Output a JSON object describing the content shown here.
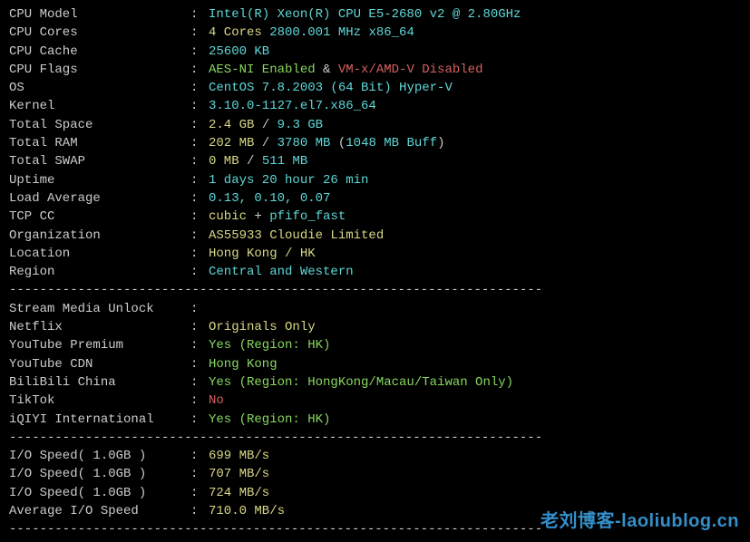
{
  "divider": "----------------------------------------------------------------------",
  "system": [
    {
      "label": "CPU Model",
      "segments": [
        {
          "t": "Intel(R) Xeon(R) CPU E5-2680 v2 @ 2.80GHz",
          "c": "cyan"
        }
      ]
    },
    {
      "label": "CPU Cores",
      "segments": [
        {
          "t": "4 Cores",
          "c": "yellow"
        },
        {
          "t": " ",
          "c": "white"
        },
        {
          "t": "2800.001 MHz",
          "c": "cyan"
        },
        {
          "t": " ",
          "c": "white"
        },
        {
          "t": "x86_64",
          "c": "cyan"
        }
      ]
    },
    {
      "label": "CPU Cache",
      "segments": [
        {
          "t": "25600 KB",
          "c": "cyan"
        }
      ]
    },
    {
      "label": "CPU Flags",
      "segments": [
        {
          "t": "AES-NI Enabled",
          "c": "green"
        },
        {
          "t": " & ",
          "c": "white"
        },
        {
          "t": "VM-x/AMD-V Disabled",
          "c": "red"
        }
      ]
    },
    {
      "label": "OS",
      "segments": [
        {
          "t": "CentOS 7.8.2003 (64 Bit)",
          "c": "cyan"
        },
        {
          "t": " ",
          "c": "white"
        },
        {
          "t": "Hyper-V",
          "c": "cyan"
        }
      ]
    },
    {
      "label": "Kernel",
      "segments": [
        {
          "t": "3.10.0-1127.el7.x86_64",
          "c": "cyan"
        }
      ]
    },
    {
      "label": "Total Space",
      "segments": [
        {
          "t": "2.4 GB",
          "c": "yellow"
        },
        {
          "t": " / ",
          "c": "white"
        },
        {
          "t": "9.3 GB",
          "c": "cyan"
        }
      ]
    },
    {
      "label": "Total RAM",
      "segments": [
        {
          "t": "202 MB",
          "c": "yellow"
        },
        {
          "t": " / ",
          "c": "white"
        },
        {
          "t": "3780 MB",
          "c": "cyan"
        },
        {
          "t": " (",
          "c": "white"
        },
        {
          "t": "1048 MB Buff",
          "c": "cyan"
        },
        {
          "t": ")",
          "c": "white"
        }
      ]
    },
    {
      "label": "Total SWAP",
      "segments": [
        {
          "t": "0 MB",
          "c": "yellow"
        },
        {
          "t": " / ",
          "c": "white"
        },
        {
          "t": "511 MB",
          "c": "cyan"
        }
      ]
    },
    {
      "label": "Uptime",
      "segments": [
        {
          "t": "1 days 20 hour 26 min",
          "c": "cyan"
        }
      ]
    },
    {
      "label": "Load Average",
      "segments": [
        {
          "t": "0.13, 0.10, 0.07",
          "c": "cyan"
        }
      ]
    },
    {
      "label": "TCP CC",
      "segments": [
        {
          "t": "cubic",
          "c": "yellow"
        },
        {
          "t": " + ",
          "c": "white"
        },
        {
          "t": "pfifo_fast",
          "c": "cyan"
        }
      ]
    },
    {
      "label": "Organization",
      "segments": [
        {
          "t": "AS55933 Cloudie Limited",
          "c": "yellow"
        }
      ]
    },
    {
      "label": "Location",
      "segments": [
        {
          "t": "Hong Kong / HK",
          "c": "yellow"
        }
      ]
    },
    {
      "label": "Region",
      "segments": [
        {
          "t": "Central and Western",
          "c": "cyan"
        }
      ]
    }
  ],
  "stream_header": {
    "label": "Stream Media Unlock",
    "segments": []
  },
  "stream": [
    {
      "label": "Netflix",
      "segments": [
        {
          "t": "Originals Only",
          "c": "yellow"
        }
      ]
    },
    {
      "label": "YouTube Premium",
      "segments": [
        {
          "t": "Yes (Region: HK)",
          "c": "green"
        }
      ]
    },
    {
      "label": "YouTube CDN",
      "segments": [
        {
          "t": "Hong Kong",
          "c": "green"
        }
      ]
    },
    {
      "label": "BiliBili China",
      "segments": [
        {
          "t": "Yes (Region: HongKong/Macau/Taiwan Only)",
          "c": "green"
        }
      ]
    },
    {
      "label": "TikTok",
      "segments": [
        {
          "t": "No",
          "c": "red"
        }
      ]
    },
    {
      "label": "iQIYI International",
      "segments": [
        {
          "t": "Yes (Region: HK)",
          "c": "green"
        }
      ]
    }
  ],
  "io": [
    {
      "label": "I/O Speed( 1.0GB )",
      "segments": [
        {
          "t": "699 MB/s",
          "c": "yellow"
        }
      ]
    },
    {
      "label": "I/O Speed( 1.0GB )",
      "segments": [
        {
          "t": "707 MB/s",
          "c": "yellow"
        }
      ]
    },
    {
      "label": "I/O Speed( 1.0GB )",
      "segments": [
        {
          "t": "724 MB/s",
          "c": "yellow"
        }
      ]
    },
    {
      "label": "Average I/O Speed",
      "segments": [
        {
          "t": "710.0 MB/s",
          "c": "yellow"
        }
      ]
    }
  ],
  "watermark": "老刘博客-laoliublog.cn"
}
